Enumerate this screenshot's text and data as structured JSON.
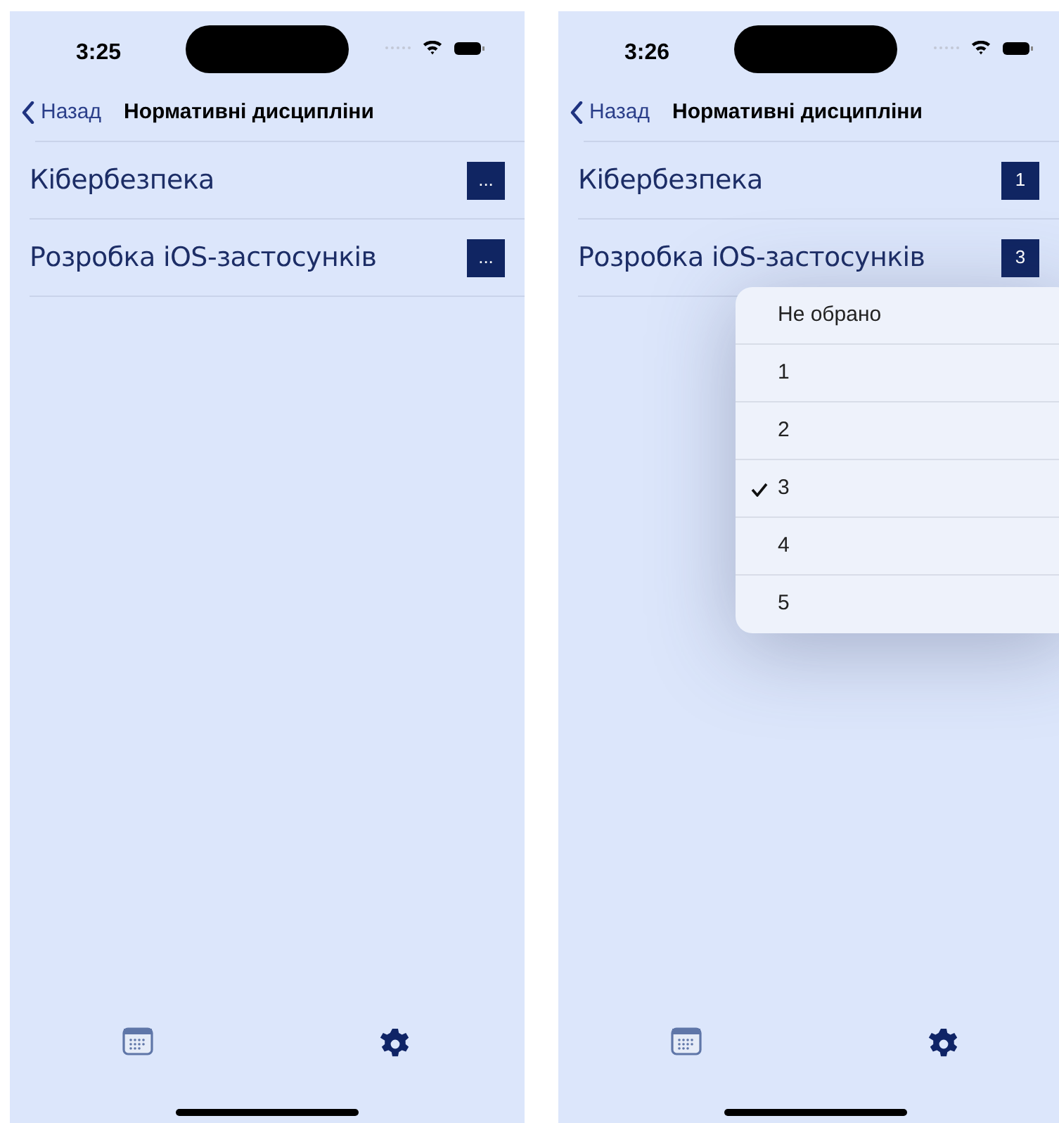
{
  "screens": [
    {
      "time": "3:25",
      "back_label": "Назад",
      "title": "Нормативні дисципліни",
      "rows": [
        {
          "name": "Кібербезпека",
          "value": "..."
        },
        {
          "name": "Розробка iOS-застосунків",
          "value": "..."
        }
      ],
      "tabs": [
        {
          "kind": "calendar",
          "selected": false
        },
        {
          "kind": "settings",
          "selected": true
        }
      ]
    },
    {
      "time": "3:26",
      "back_label": "Назад",
      "title": "Нормативні дисципліни",
      "rows": [
        {
          "name": "Кібербезпека",
          "value": "1"
        },
        {
          "name": "Розробка iOS-застосунків",
          "value": "3"
        }
      ],
      "menu": [
        {
          "label": "Не обрано",
          "selected": false
        },
        {
          "label": "1",
          "selected": false
        },
        {
          "label": "2",
          "selected": false
        },
        {
          "label": "3",
          "selected": true
        },
        {
          "label": "4",
          "selected": false
        },
        {
          "label": "5",
          "selected": false
        }
      ],
      "tabs": [
        {
          "kind": "calendar",
          "selected": false
        },
        {
          "kind": "settings",
          "selected": true
        }
      ]
    }
  ]
}
